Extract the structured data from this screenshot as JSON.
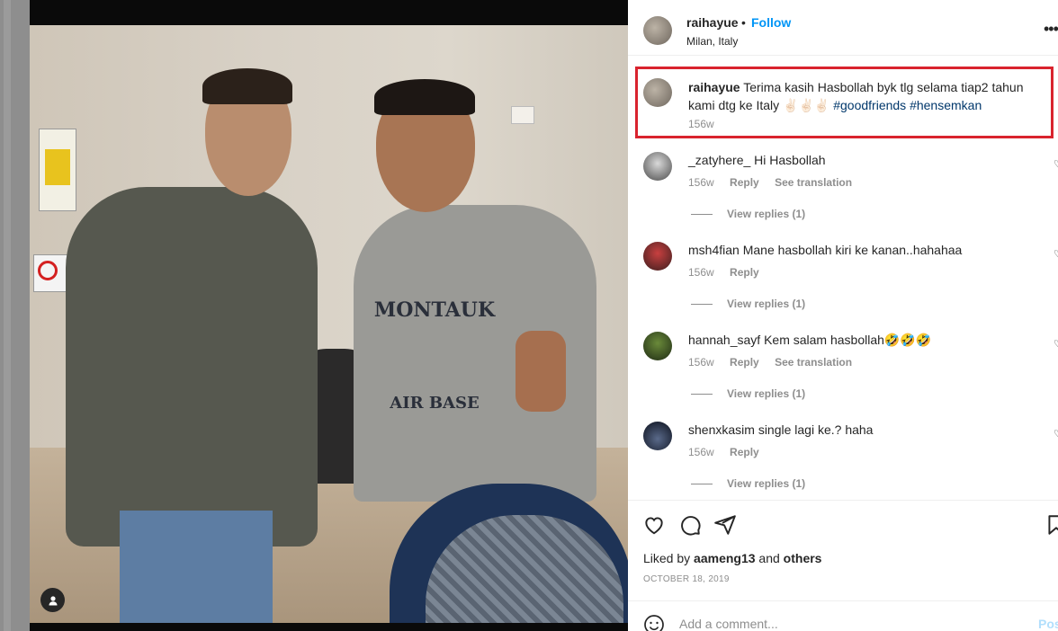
{
  "post": {
    "username": "raihayue",
    "separator": "•",
    "follow_label": "Follow",
    "location": "Milan, Italy",
    "more_label": "•••",
    "photo": {
      "shirt_text": "MONTAUK",
      "shirt_text2": "AIR BASE"
    }
  },
  "caption": {
    "username": "raihayue",
    "text": "Terima kasih Hasbollah byk tlg selama tiap2 tahun kami dtg ke Italy",
    "emojis": "✌🏻✌🏻✌🏻",
    "hashtags": "#goodfriends #hensemkan",
    "time": "156w"
  },
  "comments": [
    {
      "username": "_zatyhere_",
      "text": "Hi Hasbollah",
      "time": "156w",
      "reply": "Reply",
      "translate": "See translation",
      "replies": "View replies (1)"
    },
    {
      "username": "msh4fian",
      "text": "Mane hasbollah kiri ke kanan..hahahaa",
      "time": "156w",
      "reply": "Reply",
      "translate": "",
      "replies": "View replies (1)"
    },
    {
      "username": "hannah_sayf",
      "text": "Kem salam hasbollah🤣🤣🤣",
      "time": "156w",
      "reply": "Reply",
      "translate": "See translation",
      "replies": "View replies (1)"
    },
    {
      "username": "shenxkasim",
      "text": "single lagi ke.? haha",
      "time": "156w",
      "reply": "Reply",
      "translate": "",
      "replies": "View replies (1)"
    }
  ],
  "actions": {
    "liked_prefix": "Liked by",
    "liked_user": "aameng13",
    "liked_and": "and",
    "liked_others": "others",
    "date": "OCTOBER 18, 2019"
  },
  "comment_box": {
    "placeholder": "Add a comment...",
    "post_label": "Post"
  },
  "colors": {
    "highlight": "#d9232e",
    "follow": "#0095f6",
    "hashtag": "#00376b"
  }
}
